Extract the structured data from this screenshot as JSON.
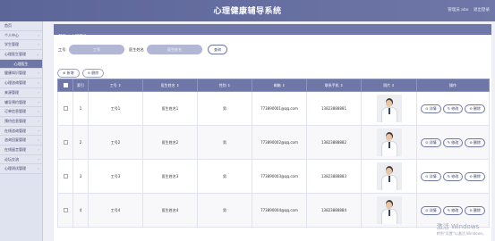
{
  "header": {
    "title": "心理健康辅导系统",
    "right_user": "管理员 abo",
    "right_logout": "退出登录"
  },
  "sidebar": {
    "items": [
      {
        "label": "首页",
        "chevron": "",
        "kind": "normal"
      },
      {
        "label": "个人中心",
        "chevron": "›",
        "kind": "normal"
      },
      {
        "label": "学生管理",
        "chevron": "›",
        "kind": "normal"
      },
      {
        "label": "心理医生管理",
        "chevron": "⌄",
        "kind": "normal"
      },
      {
        "label": "心理医生",
        "chevron": "",
        "kind": "active"
      },
      {
        "label": "健康知识管理",
        "chevron": "›",
        "kind": "normal"
      },
      {
        "label": "心理咨询管理",
        "chevron": "›",
        "kind": "normal"
      },
      {
        "label": "来源管理",
        "chevron": "›",
        "kind": "normal"
      },
      {
        "label": "辅导预约管理",
        "chevron": "›",
        "kind": "normal"
      },
      {
        "label": "订单信息管理",
        "chevron": "›",
        "kind": "normal"
      },
      {
        "label": "预约信息管理",
        "chevron": "›",
        "kind": "normal"
      },
      {
        "label": "在线咨询管理",
        "chevron": "›",
        "kind": "normal"
      },
      {
        "label": "咨询回复管理",
        "chevron": "›",
        "kind": "normal"
      },
      {
        "label": "在线留言管理",
        "chevron": "›",
        "kind": "normal"
      },
      {
        "label": "论坛交流",
        "chevron": "›",
        "kind": "normal"
      },
      {
        "label": "心理测试管理",
        "chevron": "›",
        "kind": "normal"
      }
    ]
  },
  "breadcrumb": {
    "home": "首页",
    "sep": "/",
    "current": "心理医生"
  },
  "search": {
    "label1": "工号",
    "placeholder1": "工号",
    "label2": "医生姓名",
    "placeholder2": "医生姓名",
    "button": "查询"
  },
  "actions": {
    "add": "⊕ 新增",
    "delete": "⊖ 删除"
  },
  "table": {
    "headers": [
      "",
      "索引",
      "工号 ⇕",
      "医生姓名 ⇕",
      "性别 ⇕",
      "邮箱 ⇕",
      "联系手机 ⇕",
      "照片 ⇕",
      "操作"
    ],
    "rows": [
      {
        "index": "1",
        "id": "工号1",
        "name": "医生姓名1",
        "gender": "男",
        "email": "773890001@qq.com",
        "phone": "13823888881"
      },
      {
        "index": "2",
        "id": "工号2",
        "name": "医生姓名2",
        "gender": "男",
        "email": "773890002@qq.com",
        "phone": "13823888882"
      },
      {
        "index": "3",
        "id": "工号3",
        "name": "医生姓名3",
        "gender": "男",
        "email": "773890003@qq.com",
        "phone": "13823888883"
      },
      {
        "index": "4",
        "id": "工号4",
        "name": "医生姓名4",
        "gender": "男",
        "email": "773890004@qq.com",
        "phone": "13823888884"
      }
    ],
    "ops": {
      "detail": "⊙ 详情",
      "edit": "✎ 修改",
      "remove": "⊖ 删除"
    }
  },
  "watermark": {
    "line1": "激活 Windows",
    "line2": "转到“设置”以激活 Windows。"
  },
  "colors": {
    "header": "#6f77a8",
    "sidebar": "#dfe2ef",
    "accent": "#6f77a8"
  }
}
